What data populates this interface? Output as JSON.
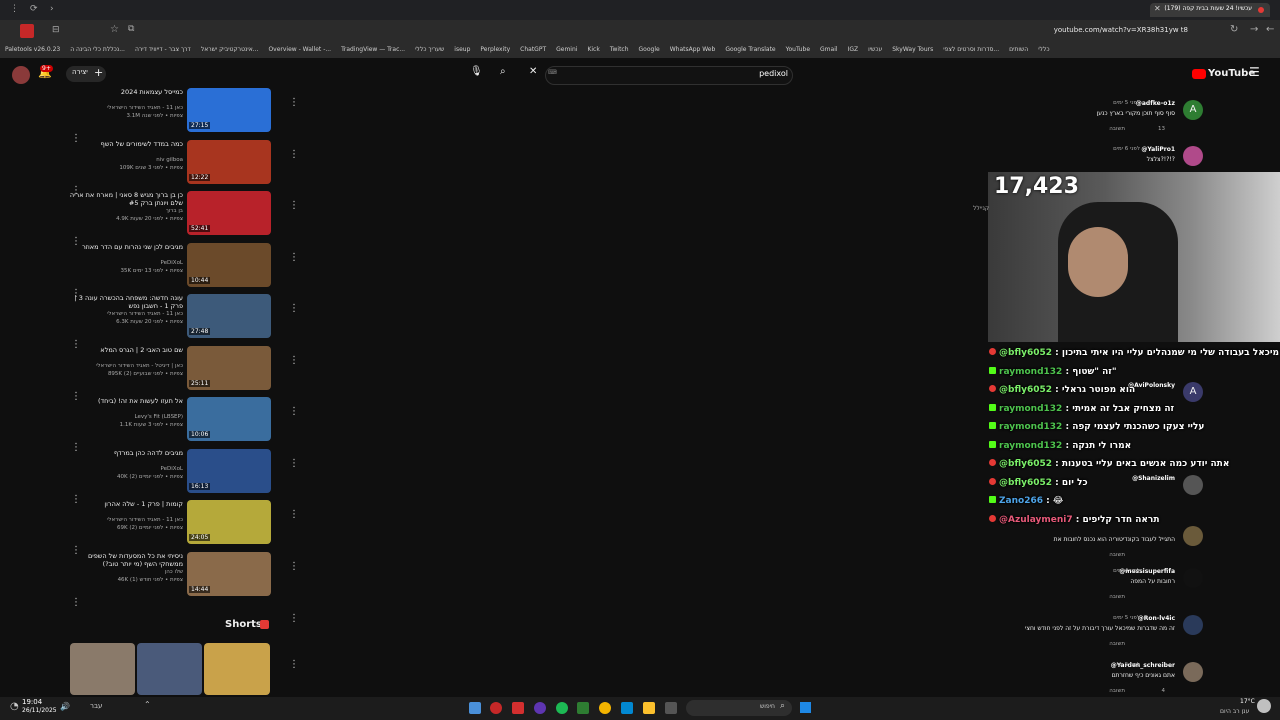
{
  "browser": {
    "tab_title": "(179) עכשיו! 24 שעות בבית קפה",
    "url": "youtube.com/watch?v=XR38h31yw t8",
    "bookmarks": [
      "Paletools v26.0.23",
      "נכללת כלי הבינה ה...",
      "דרך צבר - דייוויד דירה",
      "אינטרקטיביק ישראל...",
      "Overview - Wallet -...",
      "TradingView — Trac...",
      "שעריך כללי",
      "iseup",
      "Perplexity",
      "ChatGPT",
      "Gemini",
      "Kick",
      "Twitch",
      "Google",
      "WhatsApp Web",
      "Google Translate",
      "YouTube",
      "Gmail",
      "IGZ",
      "עכשיו",
      "SkyWay Tours",
      "סדרות וסרטים לצפי...",
      "השותים",
      "כללי"
    ]
  },
  "youtube": {
    "logo": "YouTube",
    "search_value": "pedixol",
    "create_label": "יצירה",
    "notif_count": "9+"
  },
  "videos": [
    {
      "title": "כמייסל עצמאות 2024",
      "channel": "כאן 11 - תאגיד השידור הישראלי",
      "meta": "3.1M צפיות • לפני שנה",
      "duration": "27:15",
      "color": "#2a6fd6"
    },
    {
      "title": "כמה במדד לשימורים של השף",
      "channel": "niv gilboa",
      "meta": "109K צפיות • לפני 3 שנים",
      "duration": "12:22",
      "color": "#a8351f"
    },
    {
      "title": "כן בן ברוך מגיש 8 סאני | מארח את אריה שלם ויונתן ברק #5",
      "channel": "בן ברוך",
      "meta": "4.9K צפיות • לפני 20 שעות",
      "duration": "52:41",
      "color": "#b8222a"
    },
    {
      "title": "מגיבים לכן שני נהרות עם הדר מאוזר",
      "channel": "PeDiXoL",
      "meta": "35K צפיות • לפני 13 ימים",
      "duration": "10:44",
      "color": "#6b4a2a"
    },
    {
      "title": "עונה חדשה: משפחה בהכשרה עונה 3 | פרק 1 - חשבון נפש",
      "channel": "כאן 11 - תאגיד השידור הישראלי",
      "meta": "6.3K צפיות • לפני 20 שעות",
      "duration": "27:48",
      "color": "#3d5a7a"
    },
    {
      "title": "שם טוב האבי 2 | הגרס המלא",
      "channel": "כאן | דיגיטל - תאגיד השידור הישראלי",
      "meta": "895K צפיות • לפני שבועיים (2)",
      "duration": "25:11",
      "color": "#7a5a3a"
    },
    {
      "title": "אל תעזו לעשות את זה! (ביחד)",
      "channel": "Levy's Fit (LBSEP)",
      "meta": "1.1K צפיות • לפני 3 שעות",
      "duration": "10:06",
      "color": "#3a6d9e"
    },
    {
      "title": "מגיבים לדהה כהן במרדף",
      "channel": "PeDiXoL",
      "meta": "40K צפיות • לפני יומיים (2)",
      "duration": "16:13",
      "color": "#2a4e8a"
    },
    {
      "title": "קומות | פרק 1 - שלה אהרון",
      "channel": "כאן 11 - תאגיד השידור הישראלי",
      "meta": "69K צפיות • לפני יומיים (2)",
      "duration": "24:05",
      "color": "#b5a93a"
    },
    {
      "title": "ניסיתי את כל המסעדות של השפים ממשחקי השף (מי יותר טוב?)",
      "channel": "שלו כהן",
      "meta": "46K צפיות • לפני חודש (1)",
      "duration": "14:44",
      "color": "#8a6a4a"
    }
  ],
  "shorts_label": "Shorts",
  "comments": [
    {
      "user": "@adfke-o1z",
      "time": "לפני 5 ימים",
      "text": "סוף סוף תוכן מקורי בארץ כנען",
      "likes": "13",
      "reply": "תשובה",
      "avatar_letter": "A",
      "avatar_color": "#2e7d32"
    },
    {
      "user": "@YaliPro1",
      "time": "לפני 6 ימים",
      "text": "צלצל?!?!?",
      "likes": "",
      "reply": "תשובה",
      "avatar_letter": "",
      "avatar_color": "#b04a8a"
    },
    {
      "user": "@AviPolonsky",
      "time": "",
      "text": "",
      "likes": "",
      "reply": "",
      "avatar_letter": "A",
      "avatar_color": "#3a3a6a"
    },
    {
      "user": "@Shanizelim",
      "time": "",
      "text": "",
      "likes": "",
      "reply": "",
      "avatar_letter": "",
      "avatar_color": "#555"
    },
    {
      "user": "",
      "time": "",
      "text": "התגייל לעבוד בקונדיטוריה הוא נכנס לחובות את",
      "likes": "",
      "reply": "תשובה",
      "avatar_letter": "",
      "avatar_color": "#6a5a3a"
    },
    {
      "user": "@messisuperfifa",
      "time": "לפני 4 ימים",
      "text": "רחובות על המפה",
      "likes": "",
      "reply": "תשובה",
      "avatar_letter": "",
      "avatar_color": "#111"
    },
    {
      "user": "@Ron-lv4ic",
      "time": "לפני 5 ימים",
      "text": "זה מה שדברות שמיכאל עורך דיבורת על זה לפני חודש וחצי",
      "likes": "",
      "reply": "תשובה",
      "avatar_letter": "",
      "avatar_color": "#2a3a5a"
    },
    {
      "user": "@Yarden_schreiber",
      "time": "לפני 5 ימים",
      "text": "אתם גאונים כיף שחזרתם",
      "likes": "4",
      "reply": "תשובה",
      "avatar_letter": "",
      "avatar_color": "#7a6a5a"
    }
  ],
  "stream": {
    "viewer_count": "17,423",
    "side_label": "קניילל"
  },
  "chat": [
    {
      "user": "@bfly6052",
      "msg": "מיכאל בעבודה שלי מי שמנהלים עליי היו איתי בתיכון",
      "color": "#7cf06a",
      "badge": "red"
    },
    {
      "user": "raymond132",
      "msg": "זה \"שטוף\"",
      "color": "#4ec34e",
      "badge": "green"
    },
    {
      "user": "@bfly6052",
      "msg": "הוא מפוטר גראלי",
      "color": "#7cf06a",
      "badge": "red"
    },
    {
      "user": "raymond132",
      "msg": "זה מצחיק אבל זה אמיתי",
      "color": "#4ec34e",
      "badge": "green"
    },
    {
      "user": "raymond132",
      "msg": "עליי צעקו כשהכנתי לעצמי קפה",
      "color": "#4ec34e",
      "badge": "green"
    },
    {
      "user": "raymond132",
      "msg": "אמרו לי תנקה",
      "color": "#4ec34e",
      "badge": "green"
    },
    {
      "user": "@bfly6052",
      "msg": "אתה יודע כמה אנשים באים עליי בטענות",
      "color": "#7cf06a",
      "badge": "red"
    },
    {
      "user": "@bfly6052",
      "msg": "כל יום",
      "color": "#7cf06a",
      "badge": "red"
    },
    {
      "user": "Zano266",
      "msg": "😂",
      "color": "#4ea4e8",
      "badge": "green"
    },
    {
      "user": "@Azulaymeni7",
      "msg": "תראה חדר קליפים",
      "color": "#e85a7a",
      "badge": "red"
    }
  ],
  "taskbar": {
    "time": "19:04",
    "date": "26/11/2025",
    "lang": "עבר",
    "search_label": "חיפוש",
    "weather": "17°C",
    "weather_desc": "ענן רב היום"
  }
}
